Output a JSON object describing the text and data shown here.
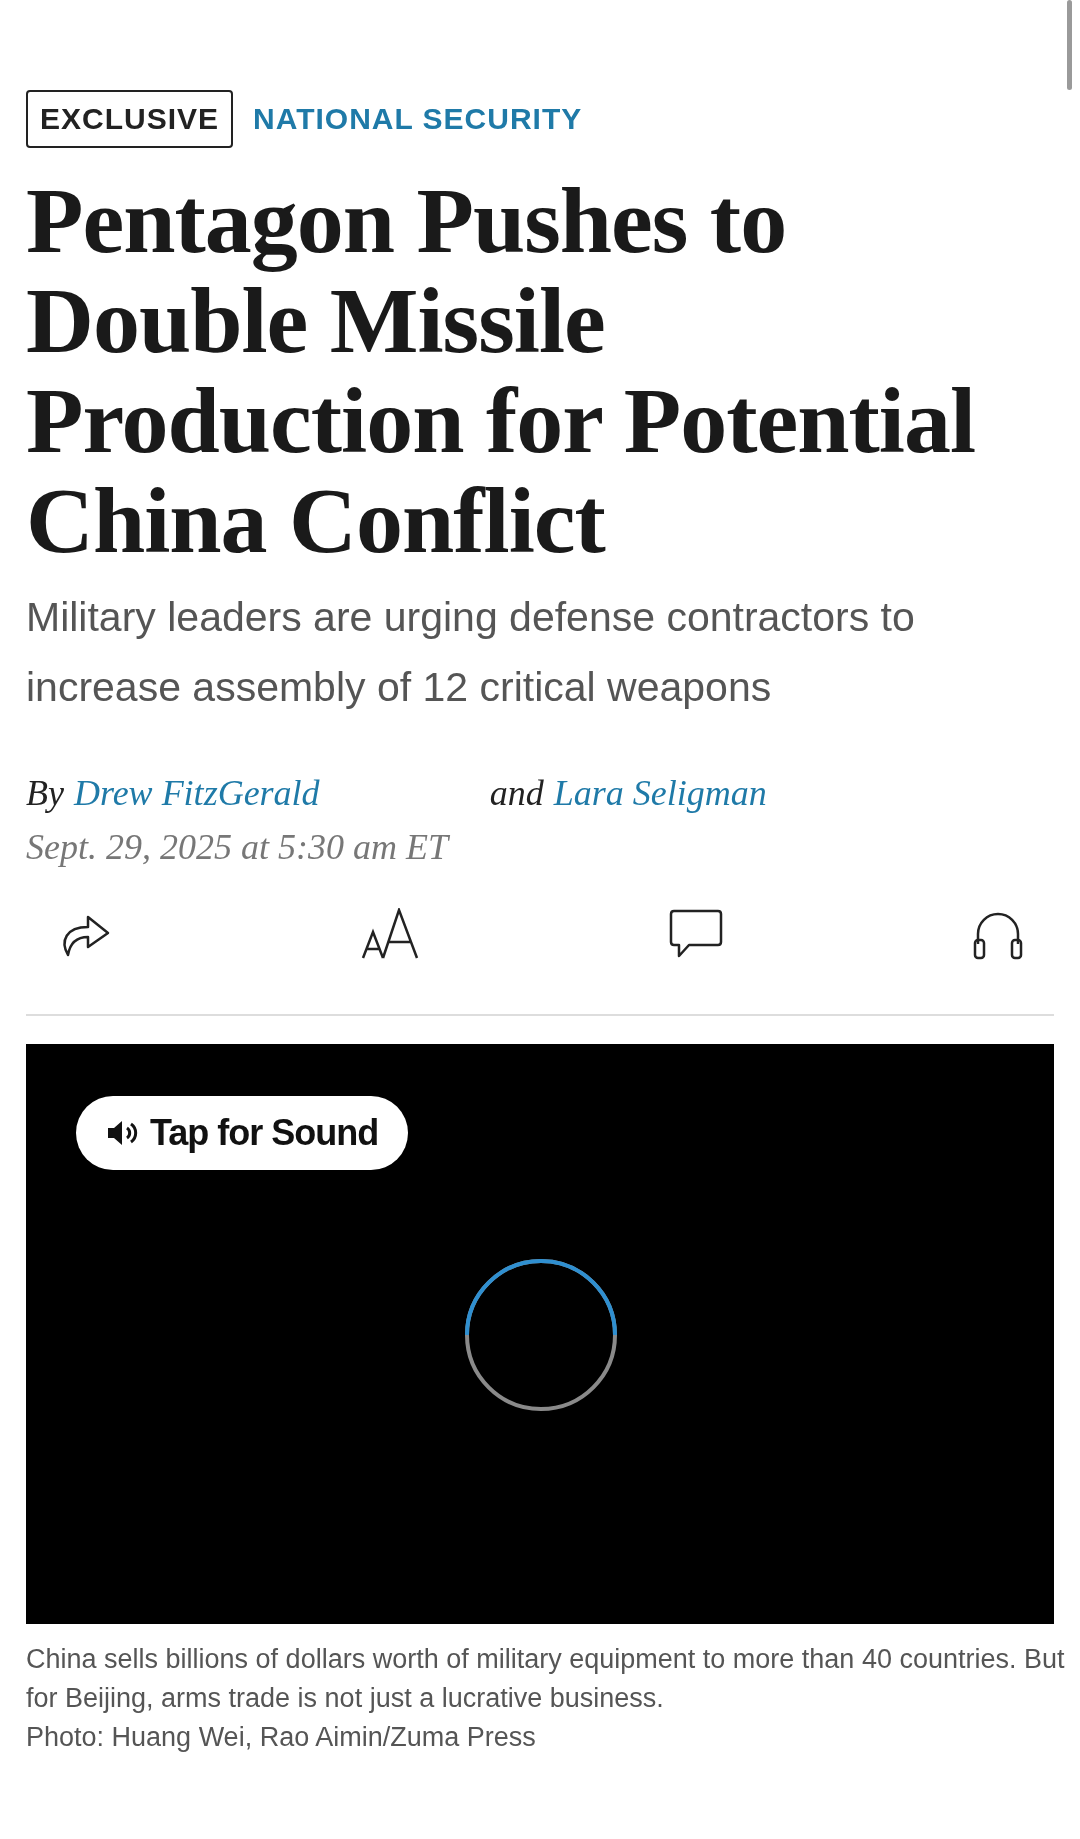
{
  "tags": [
    {
      "label": "EXCLUSIVE",
      "kind": "boxed"
    },
    {
      "label": "NATIONAL SECURITY",
      "kind": "section"
    }
  ],
  "headline": "Pentagon Pushes to Double Missile Production for Potential China Conflict",
  "dek": "Military leaders are urging defense contractors to increase assembly of 12 critical weapons",
  "byline": {
    "prefix": "By",
    "authors": [
      "Drew FitzGerald",
      "Lara Seligman"
    ],
    "joiner": "and"
  },
  "date": "Sept. 29, 2025 at 5:30 am ET",
  "toolbar": [
    {
      "kind": "share"
    },
    {
      "kind": "text-size"
    },
    {
      "kind": "comments"
    },
    {
      "kind": "listen"
    }
  ],
  "video": {
    "sound_button": "Tap for Sound",
    "loading": true
  },
  "caption": "China sells billions of dollars worth of military equipment to more than 40 countries. But for Beijing, arms trade is not just a lucrative business.",
  "credit": "Photo: Huang Wei, Rao Aimin/Zuma Press"
}
